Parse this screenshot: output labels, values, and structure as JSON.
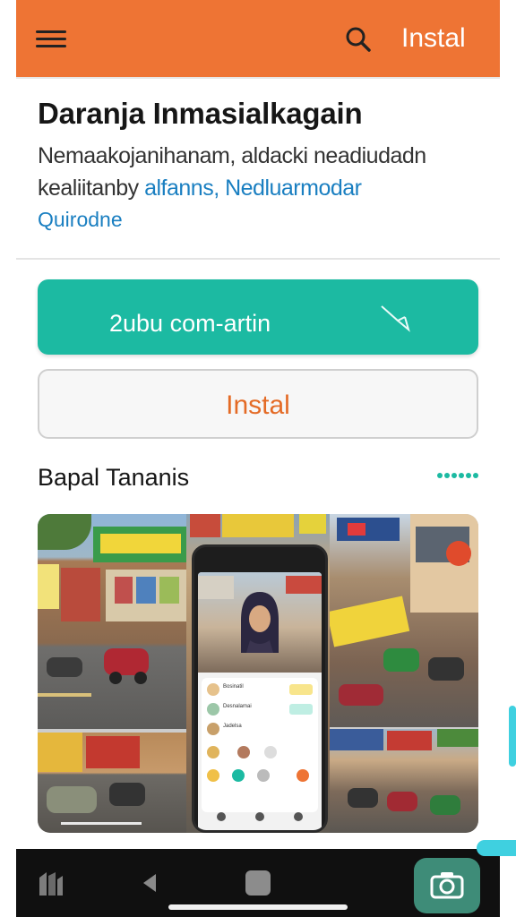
{
  "appbar": {
    "install_label": "Instal",
    "menu_icon": "hamburger-menu-icon",
    "search_icon": "search-icon",
    "bg_color": "#ee7434"
  },
  "header": {
    "title": "Daranja Inmasialkagain",
    "desc_line1": "Nemaakojanihanam, aldacki neadiudadn",
    "desc_line2_text": "kealiitanby ",
    "desc_line2_link": "alfanns, Nedluarmodar",
    "desc_line3": "Quirodne"
  },
  "actions": {
    "primary_label": "2ubu com-artin",
    "primary_icon": "arrow-icon",
    "primary_color": "#1cbaa2",
    "secondary_label": "Instal",
    "secondary_color": "#e46b26"
  },
  "gallery": {
    "title": "Bapal Tananis",
    "more_icon": "more-dots-icon",
    "mock_rows": [
      "Bosinatil",
      "Desnalamai",
      "Jadelsa"
    ]
  },
  "system": {
    "home_icon": "app-drawer-icon",
    "back_icon": "back-icon",
    "recents_icon": "recents-icon",
    "camera_icon": "camera-icon"
  }
}
